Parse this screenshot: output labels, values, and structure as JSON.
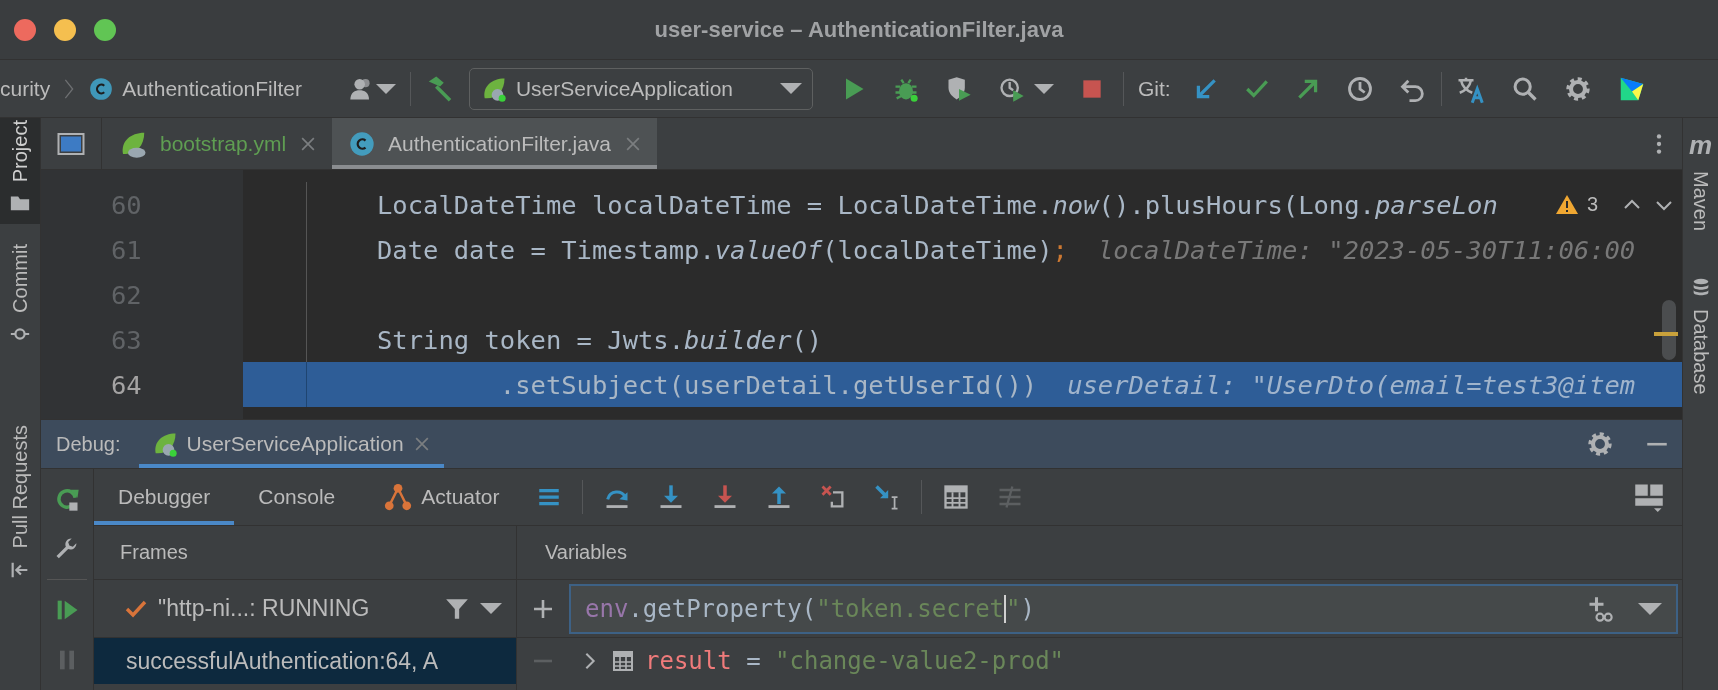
{
  "window": {
    "title": "user-service – AuthenticationFilter.java"
  },
  "breadcrumb": [
    {
      "label": "curity",
      "kind": "package"
    },
    {
      "label": "AuthenticationFilter",
      "kind": "class"
    }
  ],
  "run_config": {
    "label": "UserServiceApplication"
  },
  "git_label": "Git:",
  "left_stripe": [
    {
      "label": "Project",
      "kind": "project",
      "selected": true
    },
    {
      "label": "Commit",
      "kind": "commit",
      "selected": false
    },
    {
      "label": "Pull Requests",
      "kind": "pull",
      "selected": false
    }
  ],
  "right_stripe": [
    {
      "label": "Maven",
      "kind": "maven",
      "glyph": "m"
    },
    {
      "label": "Database",
      "kind": "database"
    }
  ],
  "editor_tabs": [
    {
      "label": "bootstrap.yml",
      "kind": "yaml",
      "color": "#5f9e52",
      "selected": false
    },
    {
      "label": "AuthenticationFilter.java",
      "kind": "class",
      "color": "#bbbbbb",
      "selected": true
    }
  ],
  "inspection": {
    "count": "3"
  },
  "code_lines": [
    {
      "number": "60",
      "selected": false,
      "tokens": [
        {
          "text": "LocalDateTime localDateTime = LocalDateTime.",
          "kind": "plain"
        },
        {
          "text": "now",
          "kind": "method"
        },
        {
          "text": "().plusHours(Long.",
          "kind": "plain"
        },
        {
          "text": "parseLon",
          "kind": "method"
        }
      ]
    },
    {
      "number": "61",
      "selected": false,
      "tokens": [
        {
          "text": "Date date = Timestamp.",
          "kind": "plain"
        },
        {
          "text": "valueOf",
          "kind": "method"
        },
        {
          "text": "(localDateTime)",
          "kind": "plain"
        },
        {
          "text": ";",
          "kind": "punct"
        }
      ],
      "hint": "localDateTime: \"2023-05-30T11:06:00"
    },
    {
      "number": "62",
      "selected": false
    },
    {
      "number": "63",
      "selected": false,
      "tokens": [
        {
          "text": "String token = Jwts.",
          "kind": "plain"
        },
        {
          "text": "builder",
          "kind": "method"
        },
        {
          "text": "()",
          "kind": "plain"
        }
      ]
    },
    {
      "number": "64",
      "selected": true,
      "tokens": [
        {
          "text": "        .setSubject(userDetail.getUserId())",
          "kind": "plain"
        }
      ],
      "hint": "userDetail: \"UserDto(email=test3@item"
    }
  ],
  "debug": {
    "label": "Debug:",
    "tabs": [
      {
        "label": "UserServiceApplication",
        "selected": true
      }
    ],
    "subtabs": [
      {
        "label": "Debugger",
        "kind": "debugger",
        "selected": true
      },
      {
        "label": "Console",
        "kind": "console",
        "selected": false
      },
      {
        "label": "Actuator",
        "kind": "actuator",
        "selected": false
      }
    ],
    "frames": {
      "title": "Frames",
      "thread": "\"http-ni...: RUNNING",
      "items": [
        {
          "label": "successfulAuthentication:64, A",
          "selected": true
        }
      ]
    },
    "variables": {
      "title": "Variables",
      "expression": [
        {
          "text": "env",
          "kind": "field",
          "cursor": false
        },
        {
          "text": ".getProperty(",
          "kind": "plain",
          "cursor": false
        },
        {
          "text": "\"token.secret",
          "kind": "string",
          "cursor": true
        },
        {
          "text": "\"",
          "kind": "string",
          "cursor": false
        },
        {
          "text": ")",
          "kind": "plain",
          "cursor": false
        }
      ],
      "items": [
        {
          "name": "result",
          "operator": " = ",
          "value": "\"change-value2-prod\"",
          "expanded": false
        }
      ]
    }
  }
}
